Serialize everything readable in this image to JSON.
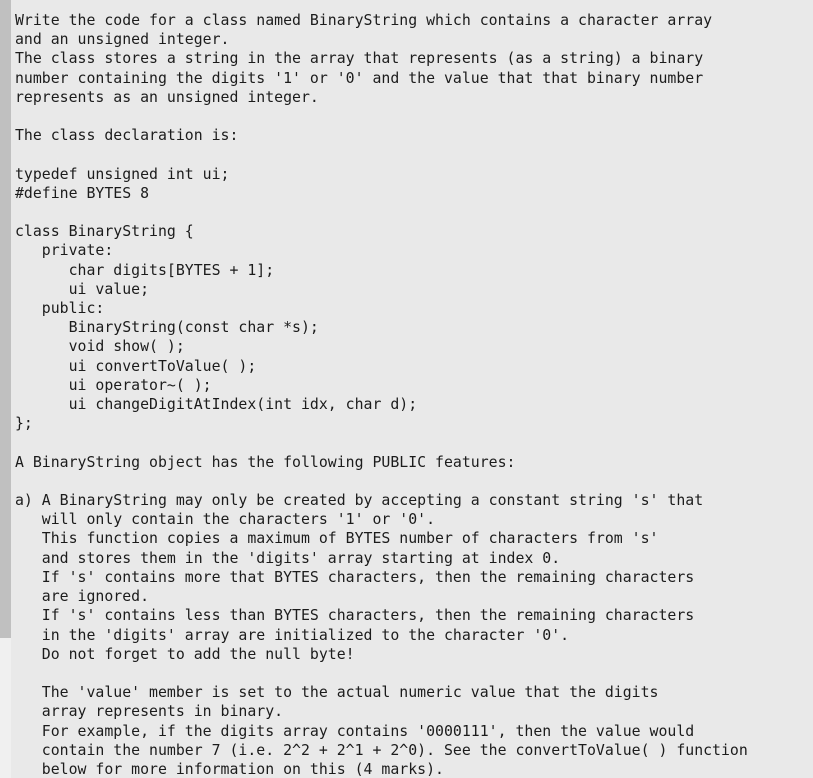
{
  "document": {
    "type": "assignment-question",
    "background_color": "#e9e9e9",
    "text_color": "#1c1c1c",
    "body": "Write the code for a class named BinaryString which contains a character array\nand an unsigned integer.\nThe class stores a string in the array that represents (as a string) a binary\nnumber containing the digits '1' or '0' and the value that that binary number\nrepresents as an unsigned integer.\n\nThe class declaration is:\n\ntypedef unsigned int ui;\n#define BYTES 8\n\nclass BinaryString {\n   private:\n      char digits[BYTES + 1];\n      ui value;\n   public:\n      BinaryString(const char *s);\n      void show( );\n      ui convertToValue( );\n      ui operator~( );\n      ui changeDigitAtIndex(int idx, char d);\n};\n\nA BinaryString object has the following PUBLIC features:\n\na) A BinaryString may only be created by accepting a constant string 's' that\n   will only contain the characters '1' or '0'.\n   This function copies a maximum of BYTES number of characters from 's'\n   and stores them in the 'digits' array starting at index 0.\n   If 's' contains more that BYTES characters, then the remaining characters\n   are ignored.\n   If 's' contains less than BYTES characters, then the remaining characters\n   in the 'digits' array are initialized to the character '0'.\n   Do not forget to add the null byte!\n\n   The 'value' member is set to the actual numeric value that the digits\n   array represents in binary.\n   For example, if the digits array contains '0000111', then the value would\n   contain the number 7 (i.e. 2^2 + 2^1 + 2^0). See the convertToValue( ) function\n   below for more information on this (4 marks)."
  },
  "scrollbar": {
    "orientation": "vertical",
    "position": "left",
    "track_color": "#f0f0f0",
    "thumb_color": "#c0c0c0"
  }
}
